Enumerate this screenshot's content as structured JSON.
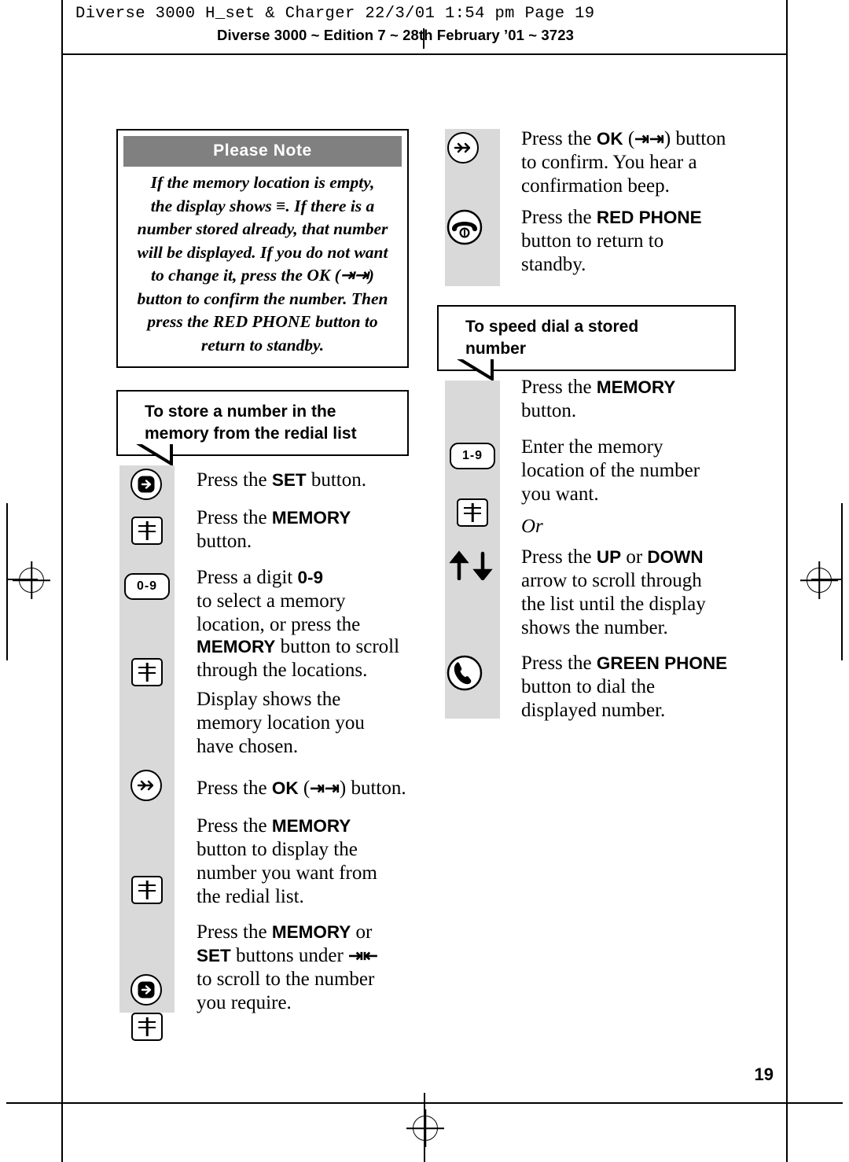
{
  "header": {
    "mono_line": "Diverse 3000 H_set & Charger   22/3/01  1:54 pm  Page 19",
    "sub_line": "Diverse 3000 ~ Edition 7 ~ 28th February ’01 ~ 3723"
  },
  "note_box": {
    "title": "Please Note",
    "lines": [
      "If the memory location is empty,",
      "the display shows ≡. If there is a",
      "number stored already, that number",
      "will be displayed. If you do not want",
      "to change it, press the OK (⇥⇥)",
      "button to confirm the number. Then",
      "press the RED PHONE button to",
      "return to standby."
    ]
  },
  "section_store": {
    "heading_line1": "To store a number in the",
    "heading_line2": "memory from the redial list",
    "steps": [
      {
        "icon": "set-arrow-icon",
        "text": "Press the SET button."
      },
      {
        "icon": "memory-book-icon",
        "text": "Press the MEMORY button."
      },
      {
        "icon": "key-0-9",
        "key_label": "0-9",
        "text": "Press a digit 0-9 to select a memory location, or press the"
      },
      {
        "icon": "memory-book-icon",
        "text": "MEMORY button to scroll through the locations."
      },
      {
        "icon": "none",
        "text": "Display shows the memory location you have chosen."
      },
      {
        "icon": "ok-arrow-icon",
        "text": "Press the OK (⇥⇥) button."
      },
      {
        "icon": "memory-book-icon",
        "text": "Press the MEMORY button to display the number you want from the redial list."
      },
      {
        "icon": "memory-book-icon",
        "text": "Press the MEMORY or"
      },
      {
        "icon": "set-arrow-icon",
        "text": "SET buttons under ⇥⇤ to scroll to the number you require."
      }
    ]
  },
  "column_right_top": {
    "steps": [
      {
        "icon": "ok-arrow-icon",
        "text": "Press the OK (⇥⇥) button to confirm. You hear a confirmation beep."
      },
      {
        "icon": "red-phone-icon",
        "text": "Press the RED PHONE button to return to standby."
      }
    ]
  },
  "section_speeddial": {
    "heading_line1": "To speed dial a stored",
    "heading_line2": "number",
    "steps": [
      {
        "icon": "memory-book-icon",
        "text": "Press the MEMORY button."
      },
      {
        "icon": "key-1-9",
        "key_label": "1-9",
        "text": "Enter the memory location of the number you want."
      },
      {
        "icon": "none",
        "text": "Or",
        "style": "italic"
      },
      {
        "icon": "up-down-arrows-icon",
        "text": "Press the UP or DOWN arrow to scroll through the list until the display shows the number."
      },
      {
        "icon": "green-phone-icon",
        "text": "Press the GREEN PHONE button to dial the displayed number."
      }
    ]
  },
  "footer": {
    "page_number": "19"
  },
  "colors": {
    "banner_fill": "#808080",
    "rail": "#d9d9d9",
    "ink": "#000000"
  }
}
